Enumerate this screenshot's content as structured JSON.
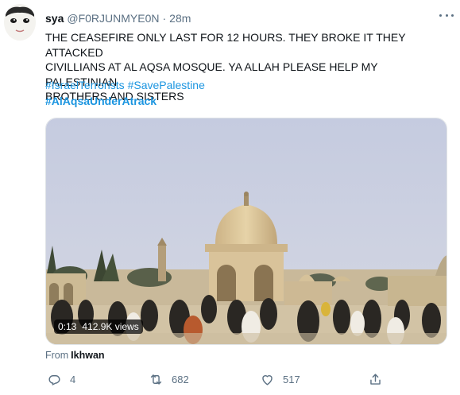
{
  "tweet": {
    "author": {
      "name": "sya",
      "handle": "@F0RJUNMYE0N",
      "separator": "·",
      "time": "28m"
    },
    "text_lines": [
      "THE CEASEFIRE ONLY LAST FOR 12 HOURS. THEY BROKE IT THEY ATTACKED",
      "CIVILLIANS AT AL AQSA MOSQUE. YA ALLAH PLEASE HELP MY PALESTINIAN",
      "BROTHERS AND SISTERS"
    ],
    "hashtags": [
      "#IsraelTerrorists",
      "#SavePalestine"
    ],
    "hashtag_bold": "#AlAqsaUnderAtrack",
    "media": {
      "duration": "0:13",
      "views": "412.9K views"
    },
    "source": {
      "prefix": "From",
      "name": "Ikhwan"
    },
    "actions": {
      "replies": "4",
      "retweets": "682",
      "likes": "517"
    }
  },
  "colors": {
    "accent": "#1b95e0",
    "muted": "#5b7083",
    "text": "#0f1419",
    "sky": "#c9cfe1",
    "dome": "#dcc79c"
  },
  "icons": [
    "more-icon",
    "reply-icon",
    "retweet-icon",
    "like-icon",
    "share-icon"
  ]
}
